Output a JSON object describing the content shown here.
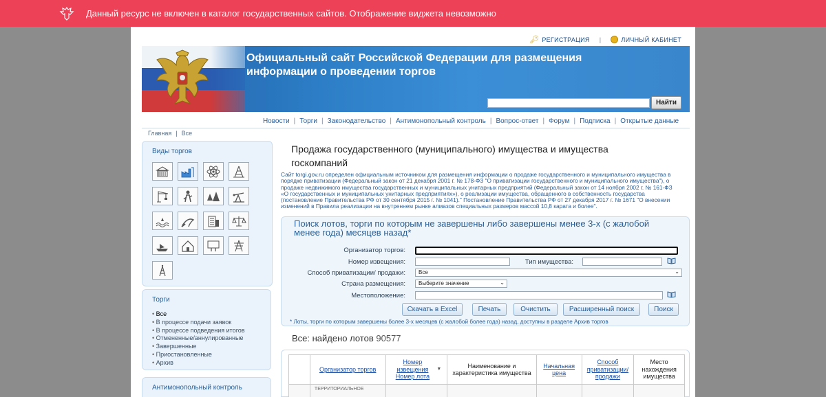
{
  "warning": {
    "text": "Данный ресурс не включен в каталог государственных сайтов. Отображение виджета невозможно"
  },
  "top_links": {
    "register": "РЕГИСТРАЦИЯ",
    "cabinet": "ЛИЧНЫЙ КАБИНЕТ"
  },
  "header": {
    "title_line1": "Официальный сайт Российской Федерации для размещения",
    "title_line2": "информации о проведении торгов",
    "search_value": "",
    "search_button": "Найти"
  },
  "nav": [
    "Новости",
    "Торги",
    "Законодательство",
    "Антимонопольный контроль",
    "Вопрос-ответ",
    "Форум",
    "Подписка",
    "Открытые данные"
  ],
  "breadcrumb": [
    "Главная",
    "Все"
  ],
  "sidebar": {
    "kinds_title": "Виды торгов",
    "tiles": [
      "building-icon",
      "factory-icon",
      "atom-icon",
      "derrick-icon",
      "crane-icon",
      "worker-icon",
      "forest-icon",
      "oil-pump-icon",
      "water-icon",
      "fishing-icon",
      "office-icon",
      "scales-icon",
      "boat-icon",
      "house-icon",
      "billboard-icon",
      "power-line-icon",
      "tower-icon"
    ],
    "active_tile": 1,
    "trades_title": "Торги",
    "trades": [
      "Все",
      "В процессе подачи заявок",
      "В процессе подведения итогов",
      "Отмененные/аннулированные",
      "Завершенные",
      "Приостановленные",
      "Архив"
    ],
    "antimono_title": "Антимонопольный контроль"
  },
  "content": {
    "title": "Продажа государственного (муниципального) имущества и имущества госкомпаний",
    "intro": "Сайт torgi.gov.ru определен официальным источником для размещения информации о продаже государственного и муниципального имущества в порядке приватизации (Федеральный закон от 21 декабря 2001 г. № 178-ФЗ \"О приватизации государственного и муниципального имущества\"), о продаже недвижимого имущества государственных и муниципальных унитарных предприятий (Федеральный закон от 14 ноября 2002 г. № 161-ФЗ «О государственных и муниципальных унитарных предприятиях»), о реализации имущества, обращенного в собственность государства (постановление Правительства РФ от 30 сентября 2015 г. № 1041).\" Постановление Правительства РФ от 27 декабря 2017 г. № 1671 \"О внесении изменений в Правила реализации на внутреннем рынке алмазов специальных размеров массой 10,8 карата и более\"."
  },
  "search": {
    "title": "Поиск лотов, торги по которым не завершены либо завершены менее 3-х (с жалобой менее года) месяцев назад*",
    "labels": {
      "organizer": "Организатор торгов:",
      "notice_no": "Номер извещения:",
      "property_type": "Тип имущества:",
      "privatization": "Способ приватизации/ продажи:",
      "country": "Страна размещения:",
      "location": "Местоположение:"
    },
    "values": {
      "organizer": "",
      "notice_no": "",
      "property_type": "",
      "privatization": "Все",
      "country": "Выберите значение",
      "location": ""
    },
    "buttons": [
      "Скачать в Excel",
      "Печать",
      "Очистить",
      "Расширенный поиск",
      "Поиск"
    ],
    "note": "* Лоты, торги по которым завершены более 3-х месяцев (с жалобой более года) назад, доступны в разделе Архив торгов"
  },
  "results": {
    "found_label": "Все: найдено лотов",
    "found_count": "90577",
    "columns": [
      {
        "text": "",
        "link": false
      },
      {
        "text": "Организатор торгов",
        "link": true
      },
      {
        "text": "Номер извещения Номер лота",
        "link": true
      },
      {
        "text": "Наименование и характеристика имущества",
        "link": false
      },
      {
        "text": "Начальная цена",
        "link": true
      },
      {
        "text": "Способ приватизации/ продажи",
        "link": true
      },
      {
        "text": "Место нахождения имущества",
        "link": false
      }
    ],
    "first_row_org": "ТЕРРИТОРИАЛЬНОЕ"
  }
}
